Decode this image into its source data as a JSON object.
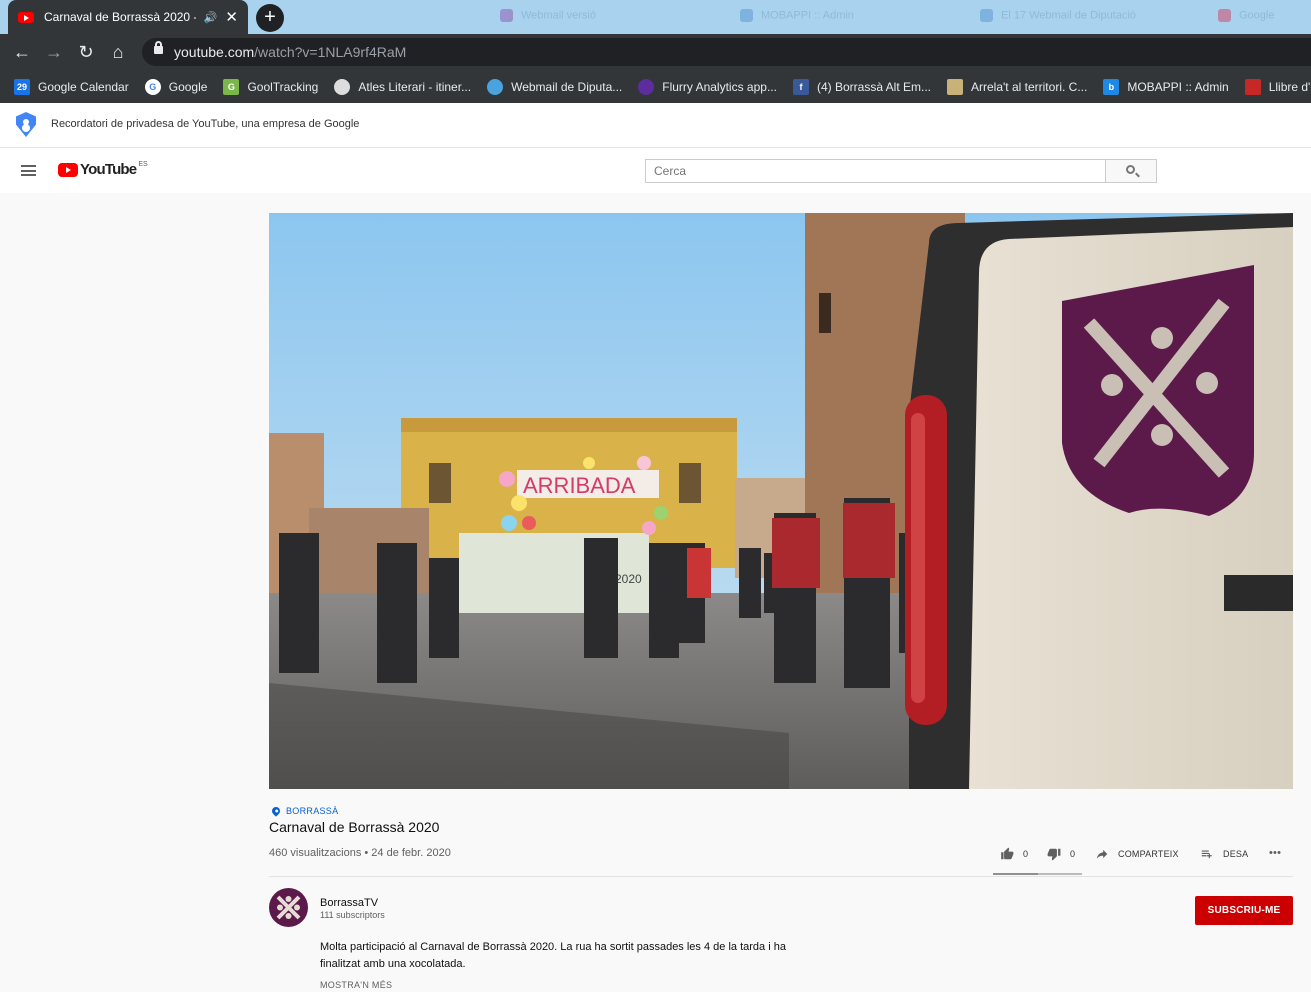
{
  "browser": {
    "active_tab_title": "Carnaval de Borrassà 2020 -",
    "new_tab_label": "+",
    "url_host": "youtube.com",
    "url_path": "/watch?v=1NLA9rf4RaM",
    "background_tabs": [
      "Webmail versió",
      "MOBAPPI :: Admin",
      "El 17 Webmail de Diputació",
      "Google"
    ]
  },
  "bookmarks": [
    {
      "label": "Google Calendar",
      "icon": "calendar-icon",
      "color": "#1a73e8",
      "badge": "29"
    },
    {
      "label": "Google",
      "icon": "google-icon",
      "color": "#ffffff",
      "badge": "G"
    },
    {
      "label": "GoolTracking",
      "icon": "gooltracking-icon",
      "color": "#7ab648",
      "badge": "G"
    },
    {
      "label": "Atles Literari - itiner...",
      "icon": "globe-icon",
      "color": "#dddddd",
      "badge": ""
    },
    {
      "label": "Webmail de Diputa...",
      "icon": "webmail-icon",
      "color": "#4aa3df",
      "badge": ""
    },
    {
      "label": "Flurry Analytics app...",
      "icon": "flurry-icon",
      "color": "#5b2d9e",
      "badge": ""
    },
    {
      "label": "(4) Borrassà Alt Em...",
      "icon": "facebook-icon",
      "color": "#3b5998",
      "badge": "f"
    },
    {
      "label": "Arrela't al territori. C...",
      "icon": "arrelat-icon",
      "color": "#c9b27a",
      "badge": ""
    },
    {
      "label": "MOBAPPI :: Admin",
      "icon": "mobappi-icon",
      "color": "#1e88e5",
      "badge": "b"
    },
    {
      "label": "Llibre d'e",
      "icon": "llibre-icon",
      "color": "#c62828",
      "badge": ""
    }
  ],
  "privacy_banner": {
    "text": "Recordatori de privadesa de YouTube, una empresa de Google"
  },
  "header": {
    "logo_text": "YouTube",
    "country_code": "ES",
    "search_placeholder": "Cerca"
  },
  "video": {
    "location": "BORRASSÀ",
    "title": "Carnaval de Borrassà 2020",
    "meta": "460 visualitzacions • 24 de febr. 2020",
    "banner_text": "ARRIBADA",
    "float_text": "2020",
    "likes": "0",
    "dislikes": "0",
    "like_ratio": 0.5,
    "share_label": "COMPARTEIX",
    "save_label": "DESA",
    "more_label": "•••"
  },
  "channel": {
    "name": "BorrassaTV",
    "subscribers": "111 subscriptors",
    "subscribe_label": "SUBSCRIU-ME",
    "description": "Molta participació al Carnaval de Borrassà 2020. La rua ha sortit passades les 4 de la tarda i ha finalitzat amb una xocolatada.",
    "show_more": "MOSTRA'N MÉS"
  },
  "colors": {
    "brand_red": "#ff0000",
    "subscribe_red": "#cc0000",
    "link_blue": "#065fd4",
    "browser_dark": "#323639",
    "tabstrip_blue": "#a9d2ee",
    "crest_purple": "#5b1a4a"
  }
}
